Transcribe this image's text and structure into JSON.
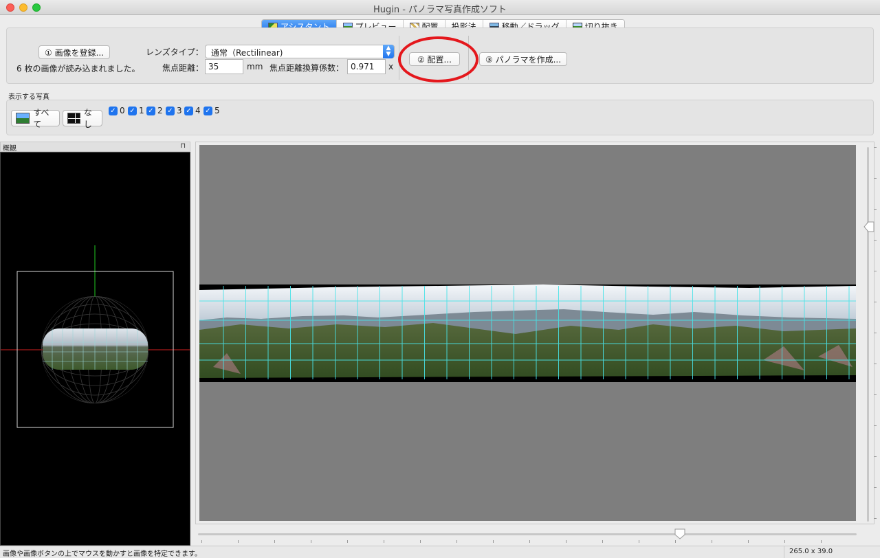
{
  "window": {
    "title": "Hugin - パノラマ写真作成ソフト"
  },
  "tabs": [
    {
      "label": "アシスタント",
      "icon": "assistant-icon"
    },
    {
      "label": "プレビュー",
      "icon": "preview-icon"
    },
    {
      "label": "配置",
      "icon": "layout-icon"
    },
    {
      "label": "投影法",
      "icon": ""
    },
    {
      "label": "移動／ドラッグ",
      "icon": "move-drag-icon"
    },
    {
      "label": "切り抜き",
      "icon": "crop-icon"
    }
  ],
  "assistant": {
    "load_images_button": "① 画像を登録...",
    "images_loaded_text": "6 枚の画像が読み込まれました。",
    "lens_type_label": "レンズタイプ：",
    "lens_type_value": "通常（Rectilinear)",
    "focal_length_label": "焦点距離：",
    "focal_length_value": "35",
    "focal_length_unit": "mm",
    "crop_factor_label": "焦点距離換算係数：",
    "crop_factor_value": "0.971",
    "crop_factor_unit": "x",
    "align_button": "② 配置...",
    "create_panorama_button": "③ パノラマを作成..."
  },
  "display_images": {
    "label": "表示する写真",
    "all_button": "すべて",
    "none_button": "なし",
    "images": [
      {
        "label": "0",
        "checked": true
      },
      {
        "label": "1",
        "checked": true
      },
      {
        "label": "2",
        "checked": true
      },
      {
        "label": "3",
        "checked": true
      },
      {
        "label": "4",
        "checked": true
      },
      {
        "label": "5",
        "checked": true
      }
    ]
  },
  "overview": {
    "title": "概観",
    "pin_glyph": "⊓"
  },
  "colors": {
    "accent": "#1f74ee",
    "highlight_circle": "#e4171c",
    "grid_line": "#48e3e8"
  },
  "statusbar": {
    "hint": "画像や画像ボタンの上でマウスを動かすと画像を特定できます。",
    "fov": "265.0 x 39.0"
  }
}
